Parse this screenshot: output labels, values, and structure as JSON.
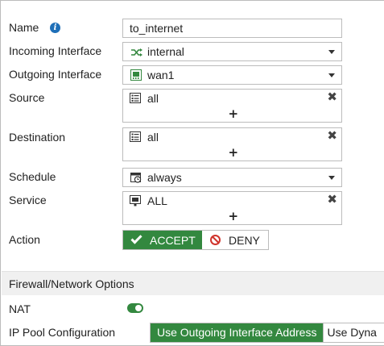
{
  "form": {
    "name": {
      "label": "Name",
      "value": "to_internet",
      "info_icon": "info-icon"
    },
    "incoming": {
      "label": "Incoming Interface",
      "value": "internal",
      "icon": "shuffle-icon"
    },
    "outgoing": {
      "label": "Outgoing Interface",
      "value": "wan1",
      "icon": "port-icon"
    },
    "source": {
      "label": "Source",
      "entries": [
        {
          "value": "all",
          "icon": "address-icon"
        }
      ],
      "add": "+"
    },
    "destination": {
      "label": "Destination",
      "entries": [
        {
          "value": "all",
          "icon": "address-icon"
        }
      ],
      "add": "+"
    },
    "schedule": {
      "label": "Schedule",
      "value": "always",
      "icon": "schedule-icon"
    },
    "service": {
      "label": "Service",
      "entries": [
        {
          "value": "ALL",
          "icon": "service-icon"
        }
      ],
      "add": "+"
    },
    "action": {
      "label": "Action",
      "accept": "ACCEPT",
      "deny": "DENY",
      "selected": "ACCEPT"
    }
  },
  "firewall_options": {
    "header": "Firewall/Network Options",
    "nat": {
      "label": "NAT",
      "enabled": true
    },
    "ip_pool": {
      "label": "IP Pool Configuration",
      "options": [
        "Use Outgoing Interface Address",
        "Use Dyna"
      ],
      "selected": "Use Outgoing Interface Address"
    }
  },
  "colors": {
    "accent_green": "#33883f",
    "info_blue": "#1e6fb8",
    "deny_red": "#d0342c",
    "border": "#bcbcbc",
    "section_bg": "#f0f0f0"
  }
}
